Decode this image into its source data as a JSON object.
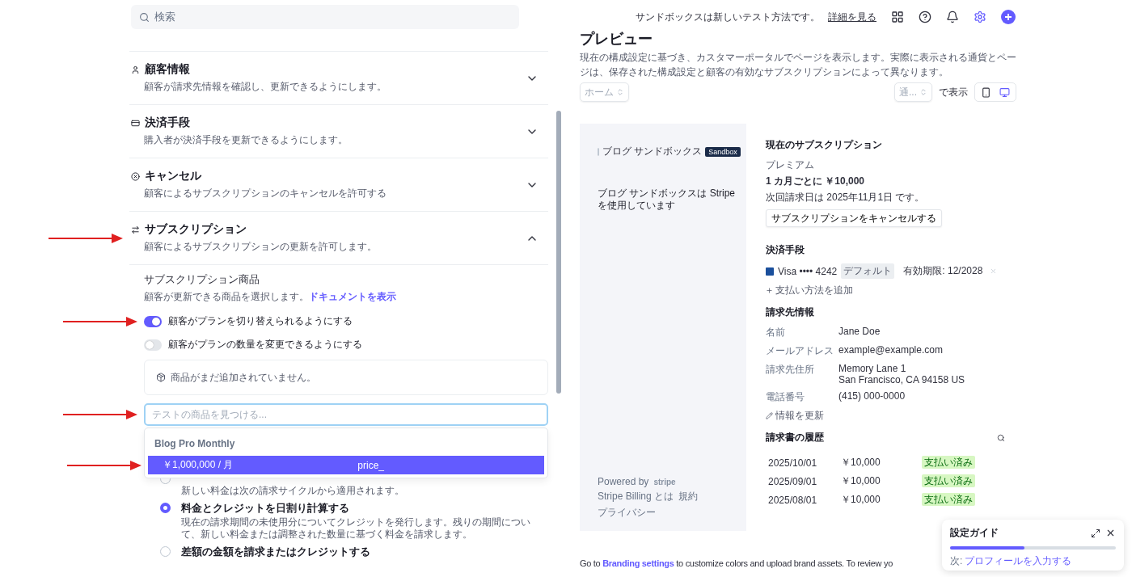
{
  "search": {
    "placeholder": "検索"
  },
  "header": {
    "notice": "サンドボックスは新しいテスト方法です。",
    "link": "詳細を見る"
  },
  "sections": [
    {
      "kind": "person",
      "title": "顧客情報",
      "description": "顧客が請求先情報を確認し、更新できるようにします。",
      "expanded": false,
      "annotated": false
    },
    {
      "kind": "card",
      "title": "決済手段",
      "description": "購入者が決済手段を更新できるようにします。",
      "expanded": false,
      "annotated": false
    },
    {
      "kind": "cancel",
      "title": "キャンセル",
      "description": "顧客によるサブスクリプションのキャンセルを許可する",
      "expanded": false,
      "annotated": false
    },
    {
      "kind": "swap",
      "title": "サブスクリプション",
      "description": "顧客によるサブスクリプションの更新を許可します。",
      "expanded": true,
      "annotated": true
    }
  ],
  "subscription_products": {
    "title": "サブスクリプション商品",
    "description": "顧客が更新できる商品を選択します。",
    "link": "ドキュメントを表示"
  },
  "toggles": [
    {
      "label": "顧客がプランを切り替えられるようにする",
      "on": true,
      "annotated": true
    },
    {
      "label": "顧客がプランの数量を変更できるようにする",
      "on": false,
      "annotated": false
    }
  ],
  "empty_products": "商品がまだ追加されていません。",
  "product_search": {
    "placeholder": "テストの商品を見つける...",
    "annotated": true
  },
  "dropdown": {
    "group": "Blog Pro Monthly",
    "options": [
      {
        "price": "￥1,000,000 / 月",
        "id": "price_",
        "selected": true,
        "annotated": true
      }
    ]
  },
  "proration_options": [
    {
      "description": "新しい料金は次の請求サイクルから適用されます。",
      "selected": false
    },
    {
      "title": "料金とクレジットを日割り計算する",
      "description": "現在の請求期間の未使用分についてクレジットを発行します。残りの期間について、新しい料金または調整された数量に基づく料金を請求します。",
      "selected": true
    },
    {
      "title": "差額の金額を請求またはクレジットする",
      "selected": false
    }
  ],
  "preview": {
    "title": "プレビュー",
    "description": "現在の構成設定に基づき、カスタマーポータルでページを表示します。実際に表示される通貨とページは、保存された構成設定と顧客の有効なサブスクリプションによって異なります。",
    "page_select": "ホーム",
    "currency_select": "通...",
    "display_label": "で表示",
    "devices": [
      {
        "kind": "mobile",
        "selected": false
      },
      {
        "kind": "desktop",
        "selected": true
      }
    ]
  },
  "portal": {
    "brand": "ブログ サンドボックス",
    "badge": "Sandbox",
    "headline": "ブログ サンドボックスは Stripe を使用しています",
    "powered_by": "Powered by",
    "stripe": "stripe",
    "footer_links": [
      "Stripe Billing とは",
      "規約",
      "プライバシー"
    ],
    "current_heading": "現在のサブスクリプション",
    "plan": "プレミアム",
    "price": "1 カ月ごとに ￥10,000",
    "next_billing": "次回請求日は 2025年11月1日 です。",
    "cancel_button": "サブスクリプションをキャンセルする",
    "payment_heading": "決済手段",
    "card": "Visa •••• 4242",
    "card_badge": "デフォルト",
    "expiry": "有効期限: 12/2028",
    "add_payment": "支払い方法を追加",
    "billing_heading": "請求先情報",
    "billing_fields": [
      {
        "label": "名前",
        "value": "Jane Doe"
      },
      {
        "label": "メールアドレス",
        "value": "example@example.com"
      },
      {
        "label": "請求先住所",
        "value": "Memory Lane 1\nSan Francisco, CA 94158 US"
      },
      {
        "label": "電話番号",
        "value": "(415) 000-0000"
      }
    ],
    "update_info": "情報を更新",
    "invoices_heading": "請求書の履歴",
    "invoices": [
      {
        "date": "2025/10/01",
        "amount": "￥10,000",
        "status": "支払い済み"
      },
      {
        "date": "2025/09/01",
        "amount": "￥10,000",
        "status": "支払い済み"
      },
      {
        "date": "2025/08/01",
        "amount": "￥10,000",
        "status": "支払い済み"
      }
    ]
  },
  "branding_note": {
    "prefix": "Go to ",
    "link": "Branding settings",
    "suffix": " to customize colors and upload brand assets. To review yo"
  },
  "guide": {
    "title": "設定ガイド",
    "level": 0.45,
    "next_label": "次:",
    "next_link": "プロフィールを入力する"
  }
}
